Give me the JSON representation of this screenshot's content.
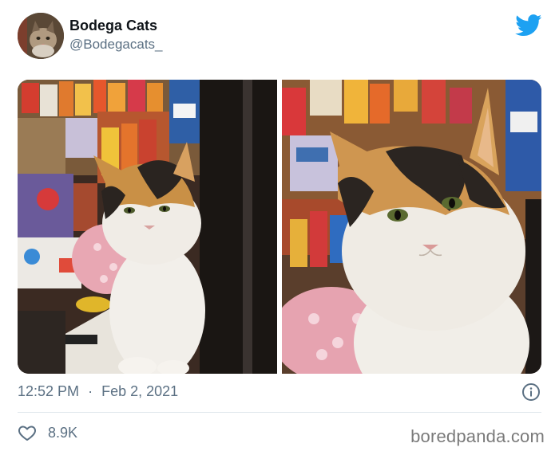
{
  "tweet": {
    "display_name": "Bodega Cats",
    "handle": "@Bodegacats_",
    "time": "12:52 PM",
    "separator": "·",
    "date": "Feb 2, 2021",
    "likes": "8.9K"
  },
  "images": [
    {
      "name": "calico-cat-photo-left",
      "subject": "calico cat sitting among bodega snacks"
    },
    {
      "name": "calico-cat-photo-right",
      "subject": "calico cat close-up in bodega"
    }
  ],
  "icons": {
    "platform": "twitter-bird-icon",
    "info": "info-icon",
    "like": "heart-icon"
  },
  "colors": {
    "brand_blue": "#1da1f2",
    "text_primary": "#0f1419",
    "text_secondary": "#5b7083",
    "divider": "#e1e8ed",
    "credit": "#7a7a7a"
  },
  "footer": {
    "credit": "boredpanda.com"
  }
}
